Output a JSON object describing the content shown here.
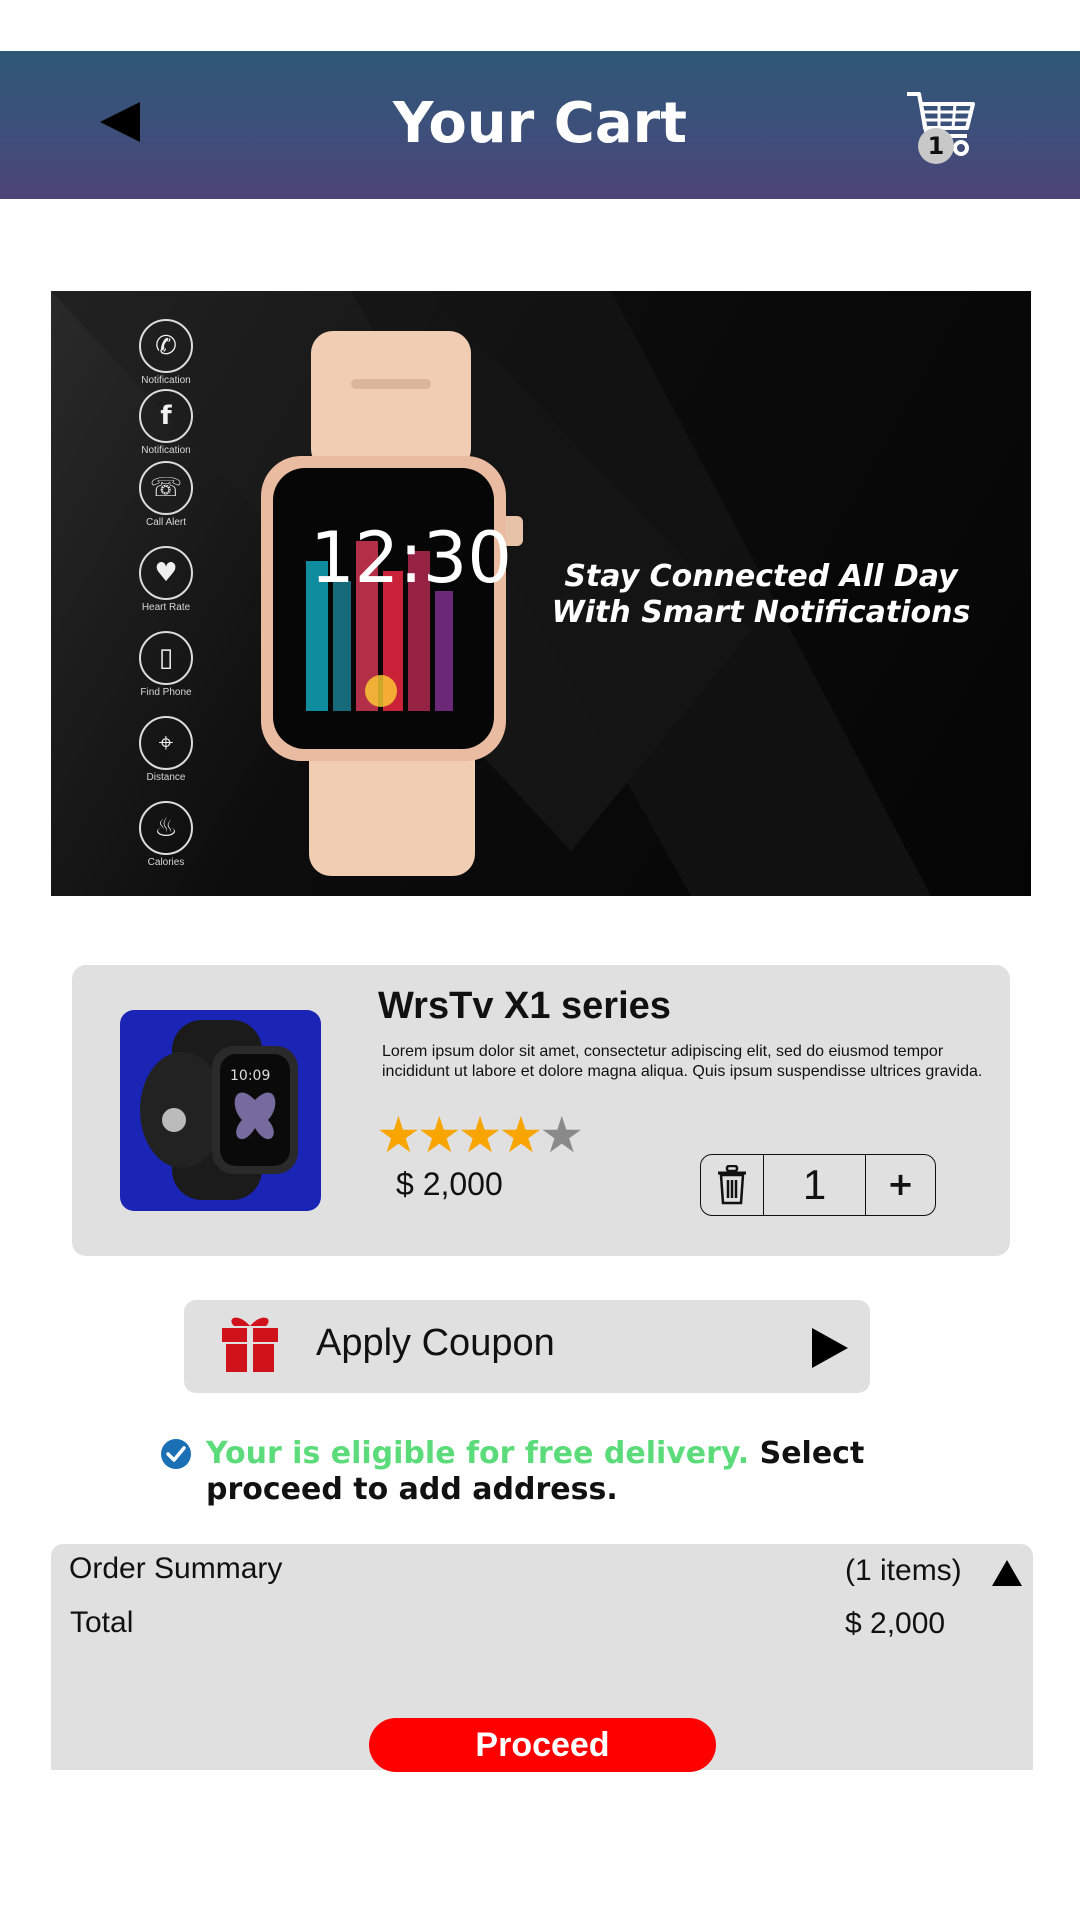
{
  "header": {
    "title": "Your Cart",
    "back_icon": "back-arrow-icon",
    "cart_icon": "shopping-cart-icon",
    "cart_count": "1",
    "gradient_colors": [
      "#2f5877",
      "#4d4477"
    ]
  },
  "banner": {
    "tagline_line1": "Stay Connected All Day",
    "tagline_line2": "With Smart Notifications",
    "watch_time": "12:30",
    "features": [
      {
        "label": "Notification",
        "icon": "whatsapp-icon"
      },
      {
        "label": "Notification",
        "icon": "facebook-icon"
      },
      {
        "label": "Call Alert",
        "icon": "phone-icon"
      },
      {
        "label": "Heart Rate",
        "icon": "heart-rate-icon"
      },
      {
        "label": "Find Phone",
        "icon": "find-phone-icon"
      },
      {
        "label": "Distance",
        "icon": "distance-icon"
      },
      {
        "label": "Calories",
        "icon": "flame-icon"
      }
    ]
  },
  "product": {
    "name": "WrsTv X1 series",
    "description": "Lorem ipsum dolor sit amet, consectetur adipiscing elit, sed do eiusmod tempor incididunt ut labore et dolore magna aliqua. Quis ipsum suspendisse ultrices gravida.",
    "rating": 4,
    "rating_max": 5,
    "price": "$ 2,000",
    "thumb_time": "10:09",
    "quantity": "1",
    "plus_label": "+",
    "star_color": "#f8a500"
  },
  "coupon": {
    "label": "Apply Coupon",
    "gift_color": "#d0121b"
  },
  "delivery": {
    "highlight": "Your is eligible for free delivery.",
    "rest": " Select proceed to add address.",
    "highlight_color": "#5cdb7a"
  },
  "summary": {
    "label": "Order Summary",
    "items": "(1 items)",
    "total_label": "Total",
    "total_value": "$ 2,000",
    "proceed_label": "Proceed",
    "proceed_color": "#ff0000"
  }
}
